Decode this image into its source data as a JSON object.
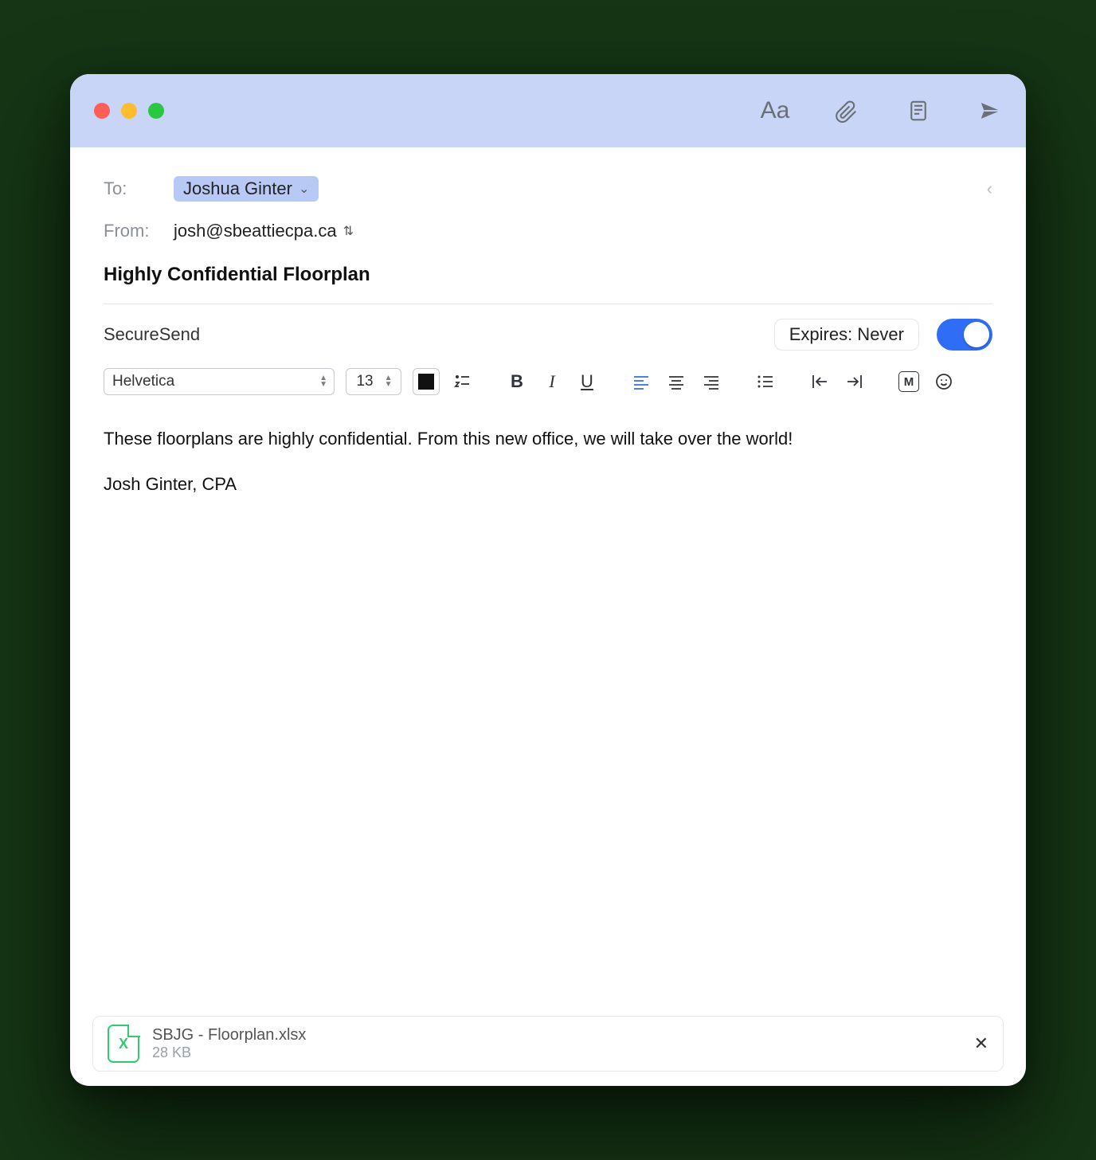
{
  "to_label": "To:",
  "from_label": "From:",
  "to_recipient": "Joshua Ginter",
  "from_address": "josh@sbeattiecpa.ca",
  "subject": "Highly Confidential Floorplan",
  "secure_label": "SecureSend",
  "expires_label": "Expires: Never",
  "secure_toggle_on": true,
  "format": {
    "font": "Helvetica",
    "size": "13",
    "color_hex": "#111111"
  },
  "body_lines": {
    "line1": "These floorplans are highly confidential. From this new office, we will take over the world!",
    "signature": "Josh Ginter, CPA"
  },
  "attachment": {
    "name": "SBJG - Floorplan.xlsx",
    "size": "28 KB",
    "kind_glyph": "X"
  }
}
